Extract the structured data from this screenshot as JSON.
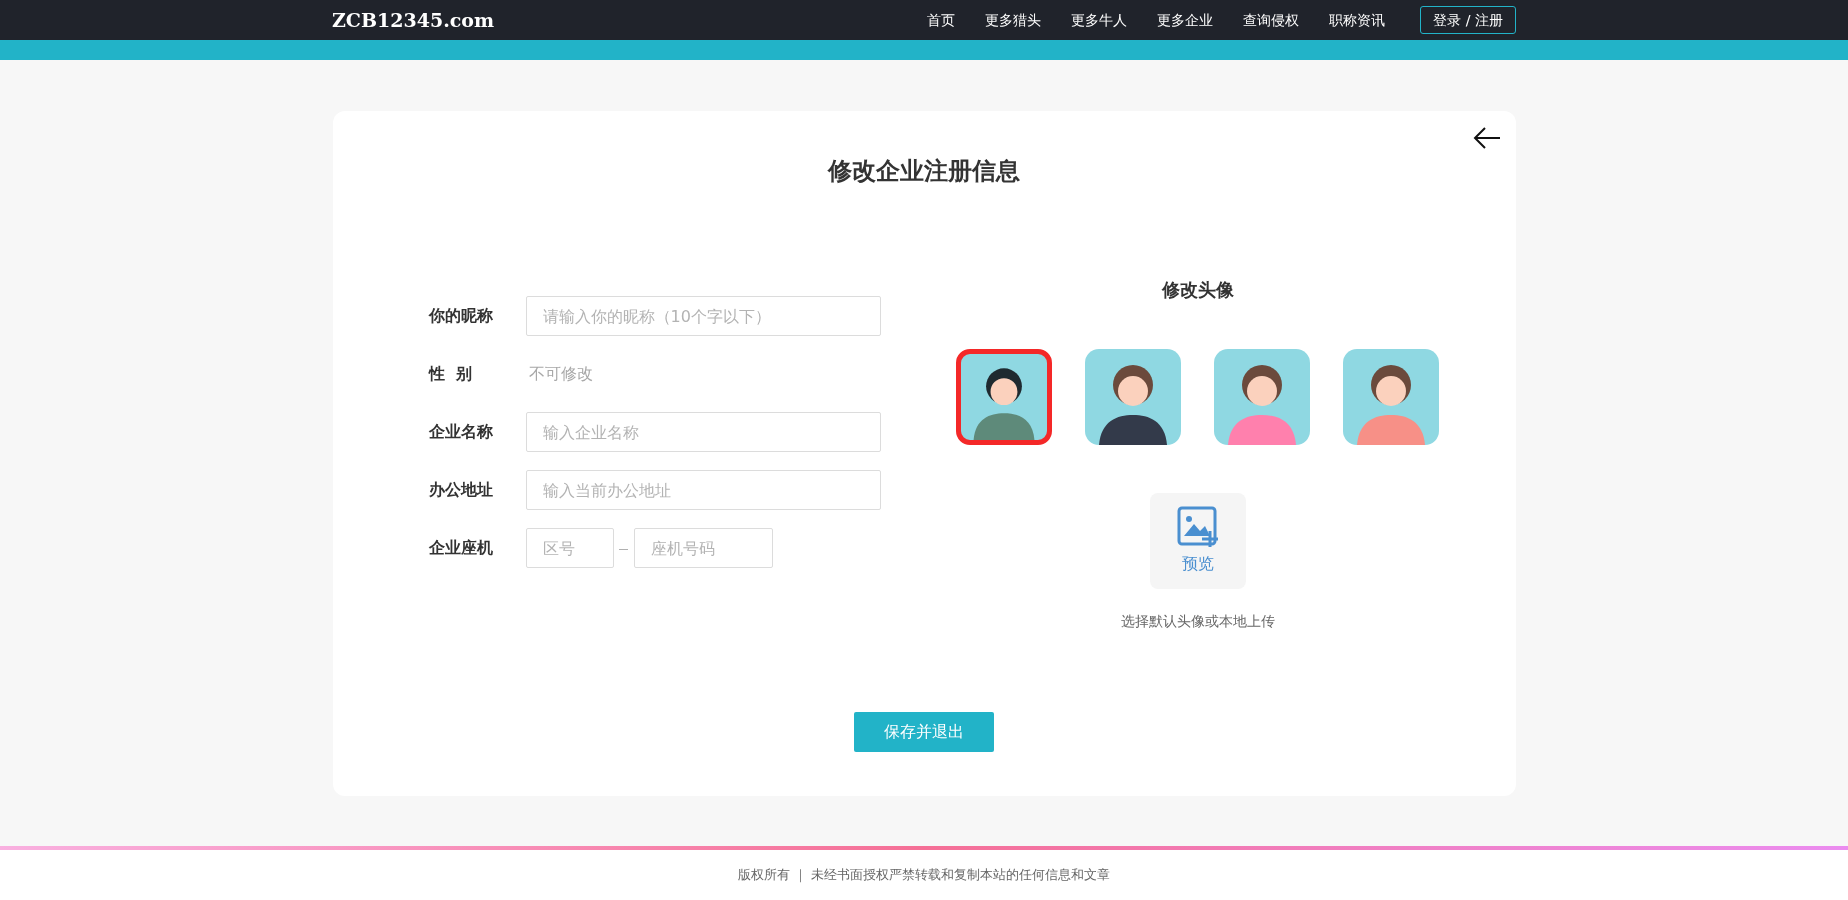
{
  "header": {
    "logo": "ZCB12345.com",
    "nav": [
      {
        "label": "首页"
      },
      {
        "label": "更多猎头"
      },
      {
        "label": "更多牛人"
      },
      {
        "label": "更多企业"
      },
      {
        "label": "查询侵权"
      },
      {
        "label": "职称资讯"
      }
    ],
    "login": "登录 / 注册"
  },
  "card": {
    "title": "修改企业注册信息",
    "form": [
      {
        "kind": "input",
        "label": "你的昵称",
        "placeholder": "请输入你的昵称（10个字以下）"
      },
      {
        "kind": "static",
        "label": "性  别",
        "value": "不可修改"
      },
      {
        "kind": "input",
        "label": "企业名称",
        "placeholder": "输入企业名称"
      },
      {
        "kind": "input",
        "label": "办公地址",
        "placeholder": "输入当前办公地址"
      },
      {
        "kind": "phone",
        "label": "企业座机",
        "area_placeholder": "区号",
        "separator": "—",
        "number_placeholder": "座机号码"
      }
    ],
    "avatar": {
      "title": "修改头像",
      "options": [
        {
          "selected": true
        },
        {
          "selected": false
        },
        {
          "selected": false
        },
        {
          "selected": false
        }
      ],
      "upload_label": "预览",
      "hint": "选择默认头像或本地上传"
    },
    "save": "保存并退出"
  },
  "footer": {
    "text": "版权所有 ｜ 未经书面授权严禁转载和复制本站的任何信息和文章"
  }
}
